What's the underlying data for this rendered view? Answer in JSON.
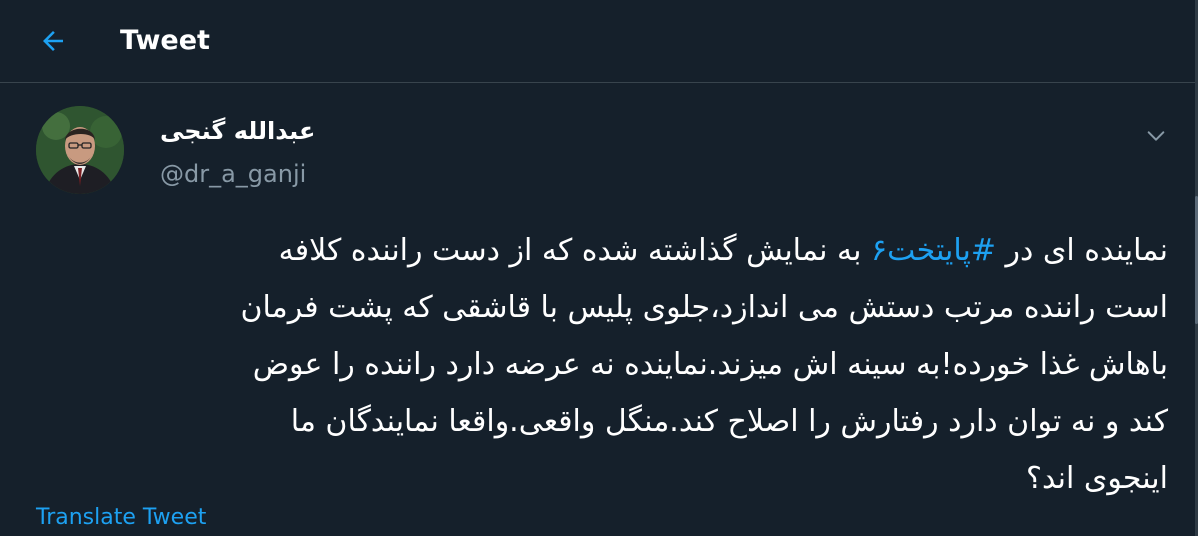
{
  "header": {
    "title": "Tweet",
    "back_icon": "arrow-left-icon"
  },
  "author": {
    "display_name": "عبدالله گنجی",
    "handle": "@dr_a_ganji",
    "avatar_icon": "profile-photo"
  },
  "tweet": {
    "lines": [
      {
        "before": "نماینده ای در ",
        "hashtag": "#پایتخت۶",
        "after": " به نمایش گذاشته شده که از دست راننده کلافه"
      },
      {
        "text": "است  راننده مرتب دستش می اندازد،جلوی پلیس با قاشقی که پشت فرمان"
      },
      {
        "text": "باهاش غذا خورده!به سینه اش میزند.نماینده نه عرضه دارد راننده را عوض"
      },
      {
        "text": "کند و نه توان دارد رفتارش را اصلاح کند.منگل واقعی.واقعا نمایندگان ما"
      },
      {
        "text": "اینجوی اند؟"
      }
    ],
    "translate_label": "Translate Tweet",
    "menu_icon": "chevron-down-icon"
  },
  "colors": {
    "background": "#15202b",
    "accent": "#1da1f2",
    "secondary_text": "#8899a6",
    "divider": "#38444d"
  }
}
